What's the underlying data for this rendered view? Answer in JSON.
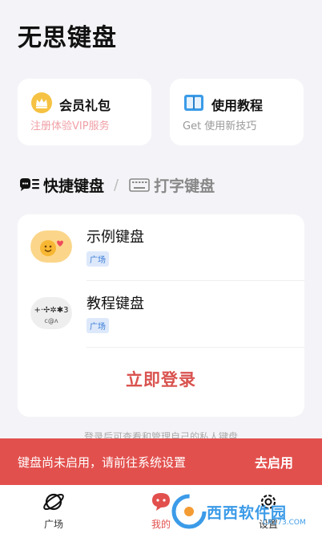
{
  "page": {
    "title": "无思键盘"
  },
  "promos": [
    {
      "title": "会员礼包",
      "subtitle": "注册体验VIP服务",
      "icon": "crown-icon"
    },
    {
      "title": "使用教程",
      "subtitle": "Get 使用新技巧",
      "icon": "book-icon"
    }
  ],
  "tabs": [
    {
      "label": "快捷键盘",
      "icon": "chat-list-icon",
      "active": true
    },
    {
      "label": "打字键盘",
      "icon": "keyboard-icon",
      "active": false
    }
  ],
  "tab_separator": "/",
  "keyboards": [
    {
      "name": "示例键盘",
      "tag": "广场"
    },
    {
      "name": "教程键盘",
      "tag": "广场"
    }
  ],
  "login_label": "立即登录",
  "hint": "登录后可查看和管理自己的私人键盘",
  "banner": {
    "message": "键盘尚未启用，请前往系统设置",
    "action": "去启用"
  },
  "nav": [
    {
      "label": "广场",
      "icon": "planet-icon",
      "active": false
    },
    {
      "label": "我的",
      "icon": "chat-bubble-icon",
      "active": true
    },
    {
      "label": "设置",
      "icon": "gear-icon",
      "active": false
    }
  ],
  "watermark": {
    "text": "西西软件园",
    "sub": "CR173.COM"
  },
  "colors": {
    "accent": "#e2504d",
    "tag": "#3a7bd5",
    "vip_sub": "#f0a0a6"
  }
}
